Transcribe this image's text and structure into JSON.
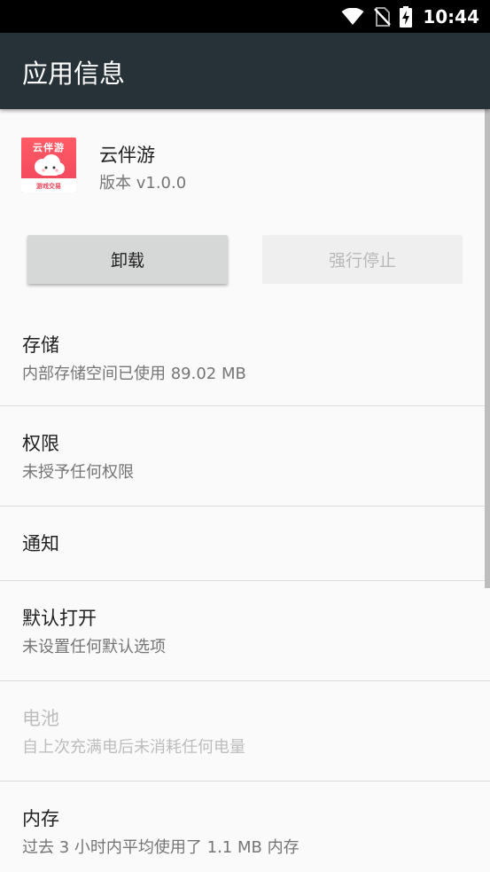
{
  "status_bar": {
    "time": "10:44",
    "icons": [
      "wifi-icon",
      "no-sim-icon",
      "battery-charging-icon"
    ]
  },
  "app_bar": {
    "title": "应用信息"
  },
  "app": {
    "name": "云伴游",
    "version": "版本 v1.0.0",
    "icon": {
      "top_text": "云伴游",
      "bottom_text": "游戏交易",
      "colors": {
        "background": "#f0445a",
        "accent": "#ffffff"
      }
    }
  },
  "buttons": {
    "uninstall": "卸载",
    "force_stop": "强行停止"
  },
  "settings": [
    {
      "title": "存储",
      "summary": "内部存储空间已使用 89.02 MB",
      "enabled": true
    },
    {
      "title": "权限",
      "summary": "未授予任何权限",
      "enabled": true
    },
    {
      "title": "通知",
      "summary": "",
      "enabled": true
    },
    {
      "title": "默认打开",
      "summary": "未设置任何默认选项",
      "enabled": true
    },
    {
      "title": "电池",
      "summary": "自上次充满电后未消耗任何电量",
      "enabled": false
    },
    {
      "title": "内存",
      "summary": "过去 3 小时内平均使用了 1.1 MB 内存",
      "enabled": true
    }
  ],
  "colors": {
    "app_bar": "#263238",
    "status_bar": "#000000",
    "background": "#fafafa",
    "primary_text": "#212121",
    "secondary_text": "#757575",
    "disabled_text": "#bdbdbd"
  }
}
